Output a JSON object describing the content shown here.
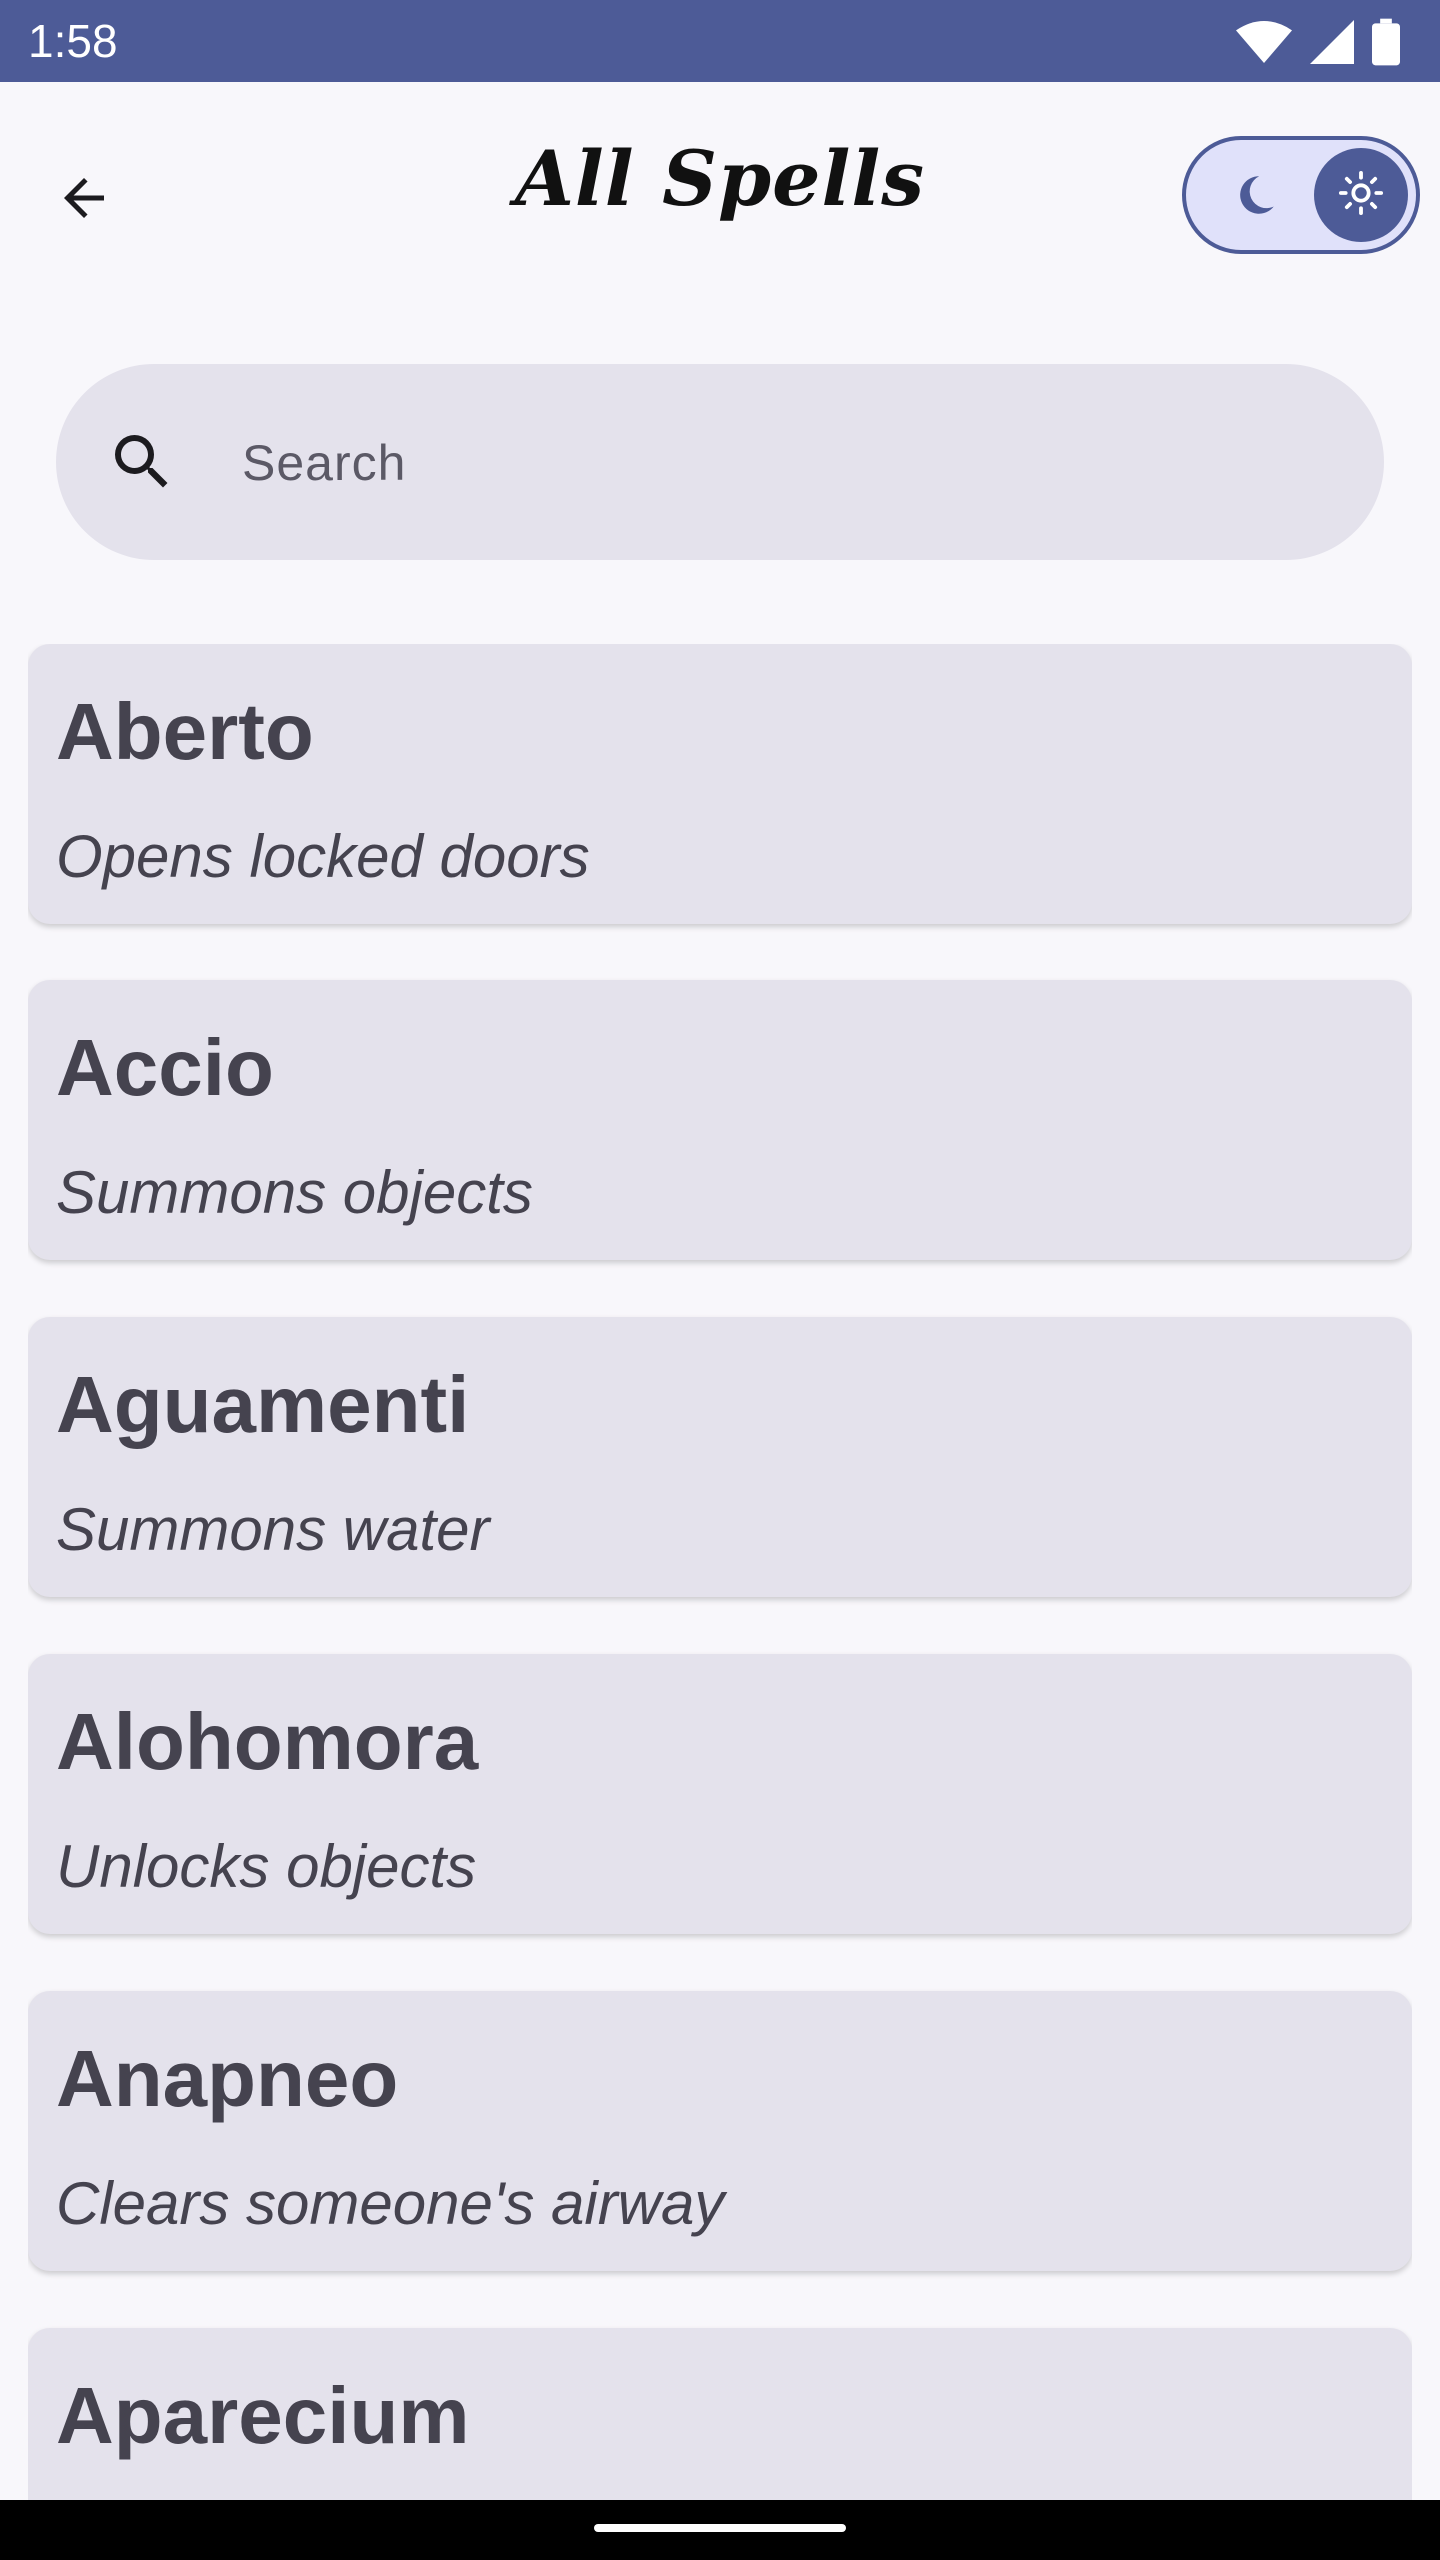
{
  "status_bar": {
    "time": "1:58",
    "icons": [
      "wifi-icon",
      "cellular-signal-icon",
      "battery-icon"
    ]
  },
  "top_bar": {
    "back_icon": "arrow-left-icon",
    "title": "All Spells",
    "theme_toggle": {
      "left_icon": "moon-icon",
      "thumb_icon": "sun-icon",
      "selected": "light"
    }
  },
  "search": {
    "icon": "search-icon",
    "placeholder": "Search",
    "value": ""
  },
  "spells": [
    {
      "name": "Aberto",
      "description": "Opens locked doors"
    },
    {
      "name": "Accio",
      "description": "Summons objects"
    },
    {
      "name": "Aguamenti",
      "description": "Summons water"
    },
    {
      "name": "Alohomora",
      "description": "Unlocks objects"
    },
    {
      "name": "Anapneo",
      "description": "Clears someone's airway"
    },
    {
      "name": "Aparecium",
      "description": ""
    }
  ],
  "colors": {
    "accent": "#4d5b97",
    "card_background": "#e4e2ec",
    "page_background": "#f8f7fb",
    "text": "#45434f"
  }
}
